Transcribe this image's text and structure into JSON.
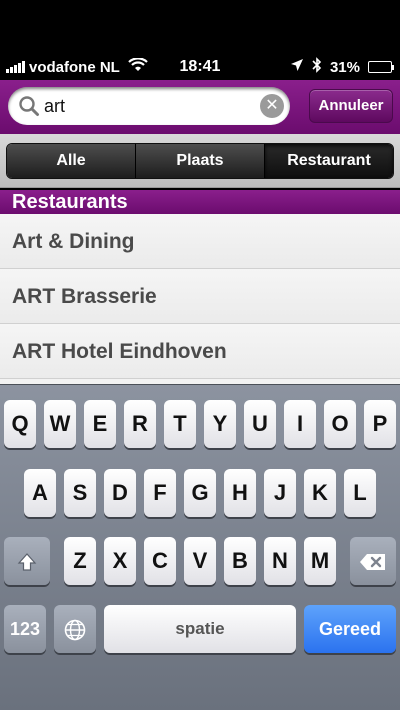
{
  "status_bar": {
    "carrier": "vodafone NL",
    "time": "18:41",
    "battery": "31%",
    "battery_level": 0.31,
    "icons": [
      "signal-icon",
      "wifi-icon",
      "location-icon",
      "bluetooth-icon",
      "battery-icon"
    ]
  },
  "search": {
    "value": "art",
    "cancel_label": "Annuleer"
  },
  "segments": [
    {
      "label": "Alle",
      "active": false
    },
    {
      "label": "Plaats",
      "active": false
    },
    {
      "label": "Restaurant",
      "active": true
    }
  ],
  "section": {
    "title": "Restaurants"
  },
  "results": [
    {
      "name": "Art & Dining"
    },
    {
      "name": "ART Brasserie"
    },
    {
      "name": "ART Hotel Eindhoven"
    }
  ],
  "keyboard": {
    "row1": [
      "Q",
      "W",
      "E",
      "R",
      "T",
      "Y",
      "U",
      "I",
      "O",
      "P"
    ],
    "row2": [
      "A",
      "S",
      "D",
      "F",
      "G",
      "H",
      "J",
      "K",
      "L"
    ],
    "row3": [
      "Z",
      "X",
      "C",
      "V",
      "B",
      "N",
      "M"
    ],
    "numbers_label": "123",
    "space_label": "spatie",
    "done_label": "Gereed"
  },
  "colors": {
    "accent_purple": "#7a167c",
    "done_blue": "#2b73ef"
  }
}
